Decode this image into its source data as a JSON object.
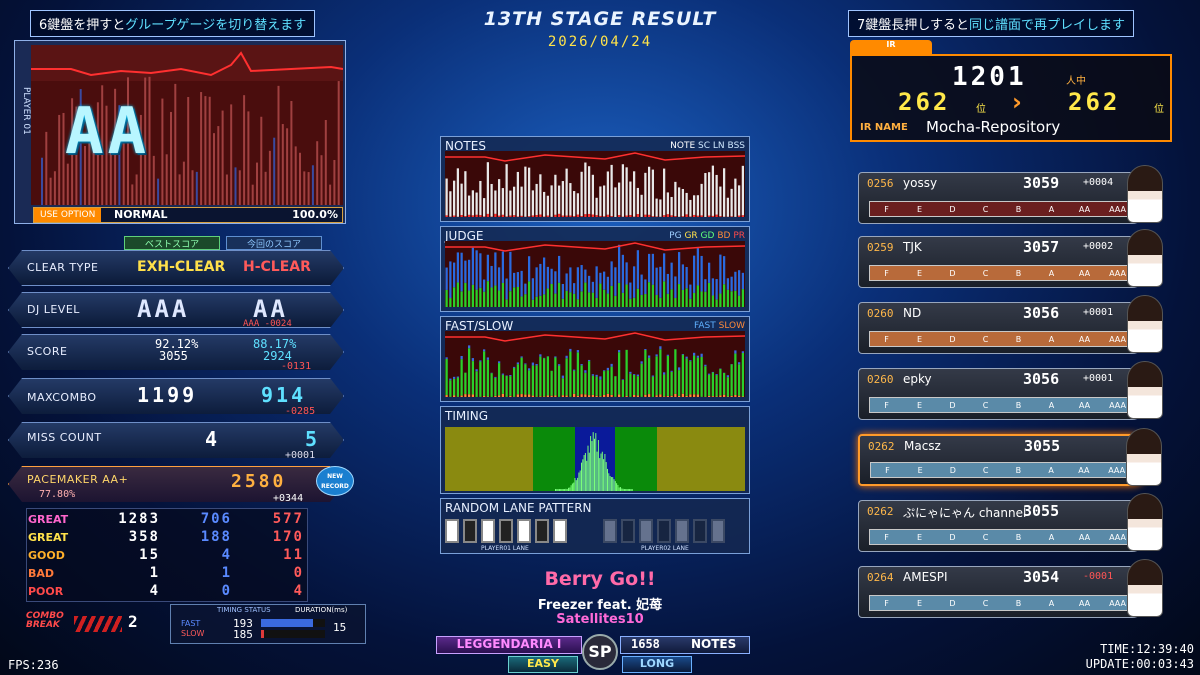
{
  "header": {
    "stage_title": "13TH STAGE RESULT",
    "date": "2026/04/24",
    "hint_left_a": "6鍵盤を押すと",
    "hint_left_b": "グループゲージを切り替えます",
    "hint_right_a": "7鍵盤長押しすると",
    "hint_right_b": "同じ譜面で再プレイします"
  },
  "gauge_panel": {
    "player": "PLAYER 01",
    "grade": "AA",
    "use_option_label": "USE OPTION",
    "option": "NORMAL",
    "percent": "100.0%"
  },
  "tabs": {
    "best": "ベストスコア",
    "current": "今回のスコア"
  },
  "stats": {
    "clear_type": {
      "label": "CLEAR TYPE",
      "best": "EXH-CLEAR",
      "current": "H-CLEAR"
    },
    "dj_level": {
      "label": "DJ LEVEL",
      "best": "AAA",
      "current": "AA",
      "diff": "AAA -0024"
    },
    "score": {
      "label": "SCORE",
      "best_rate": "92.12%",
      "best": "3055",
      "current_rate": "88.17%",
      "current": "2924",
      "diff": "-0131"
    },
    "maxcombo": {
      "label": "MAXCOMBO",
      "best": "1199",
      "current": "914",
      "diff": "-0285"
    },
    "miss_count": {
      "label": "MISS COUNT",
      "best": "4",
      "current": "5",
      "diff": "+0001"
    },
    "pacemaker": {
      "label": "PACEMAKER AA+",
      "rate": "77.80%",
      "value": "2580",
      "diff": "+0344",
      "badge": "NEW RECORD"
    }
  },
  "judge": {
    "rows": [
      {
        "label": "GREAT",
        "color": "#ff66cc",
        "a": "1283",
        "b": "706",
        "c": "577"
      },
      {
        "label": "GREAT",
        "color": "#ffe14a",
        "a": "358",
        "b": "188",
        "c": "170"
      },
      {
        "label": "GOOD",
        "color": "#ffb02a",
        "a": "15",
        "b": "4",
        "c": "11"
      },
      {
        "label": "BAD",
        "color": "#ff7a3a",
        "a": "1",
        "b": "1",
        "c": "0"
      },
      {
        "label": "POOR",
        "color": "#ff4a4a",
        "a": "4",
        "b": "0",
        "c": "4"
      }
    ]
  },
  "combo_break": {
    "label": "COMBO BREAK",
    "value": "2"
  },
  "timing": {
    "status_label": "TIMING STATUS",
    "duration_label": "DURATION(ms)",
    "fast_label": "FAST",
    "slow_label": "SLOW",
    "fast": "193",
    "slow": "185",
    "fast_fill": 0.82,
    "slow_fill": 0.05,
    "duration": "15"
  },
  "graphs": {
    "notes": {
      "title": "NOTES",
      "legend": [
        "NOTE",
        "SC",
        "LN",
        "BSS"
      ]
    },
    "judge": {
      "title": "JUDGE",
      "legend": [
        "PG",
        "GR",
        "GD",
        "BD",
        "PR"
      ]
    },
    "fastslow": {
      "title": "FAST/SLOW",
      "legend": [
        "FAST",
        "SLOW"
      ]
    },
    "timing": {
      "title": "TIMING"
    },
    "lane": {
      "title": "RANDOM LANE PATTERN",
      "p1": "PLAYER01 LANE",
      "p2": "PLAYER02 LANE"
    }
  },
  "song": {
    "title": "Berry Go!!",
    "artist": "Freezer feat. 妃苺",
    "chart_author": "Satellites10",
    "difficulty": "LEGGENDARIA Ⅰ",
    "notes": "1658",
    "notes_label": "NOTES",
    "mode": "SP",
    "gauge": "EASY",
    "ln_mode": "LONG"
  },
  "ir": {
    "tag": "IR",
    "total": "1201",
    "total_unit": "人中",
    "rank_before": "262",
    "rank_after": "262",
    "rank_unit": "位",
    "name_label": "IR NAME",
    "name": "Mocha-Repository"
  },
  "rivals": [
    {
      "rank": "0256",
      "name": "yossy",
      "score": "3059",
      "diff": "+0004",
      "diff_color": "#ffffff",
      "bar_color": "#6a1f1f"
    },
    {
      "rank": "0259",
      "name": "TJK",
      "score": "3057",
      "diff": "+0002",
      "diff_color": "#ffffff",
      "bar_color": "#b86a3a"
    },
    {
      "rank": "0260",
      "name": "ND",
      "score": "3056",
      "diff": "+0001",
      "diff_color": "#ffffff",
      "bar_color": "#b86a3a"
    },
    {
      "rank": "0260",
      "name": "epky",
      "score": "3056",
      "diff": "+0001",
      "diff_color": "#ffffff",
      "bar_color": "#5a8aa8"
    },
    {
      "rank": "0262",
      "name": "Macsz",
      "score": "3055",
      "diff": "",
      "diff_color": "#ffffff",
      "bar_color": "#5a8aa8"
    },
    {
      "rank": "0262",
      "name": "ぷにゃにゃん channel",
      "score": "3055",
      "diff": "",
      "diff_color": "#ffffff",
      "bar_color": "#5a8aa8"
    },
    {
      "rank": "0264",
      "name": "AMESPI",
      "score": "3054",
      "diff": "-0001",
      "diff_color": "#ff5555",
      "bar_color": "#5a8aa8"
    }
  ],
  "rival_bar_labels": [
    "F",
    "E",
    "D",
    "C",
    "B",
    "A",
    "AA",
    "AAA"
  ],
  "footer": {
    "fps": "FPS:236",
    "time": "TIME:12:39:40",
    "update": "UPDATE:00:03:43"
  }
}
